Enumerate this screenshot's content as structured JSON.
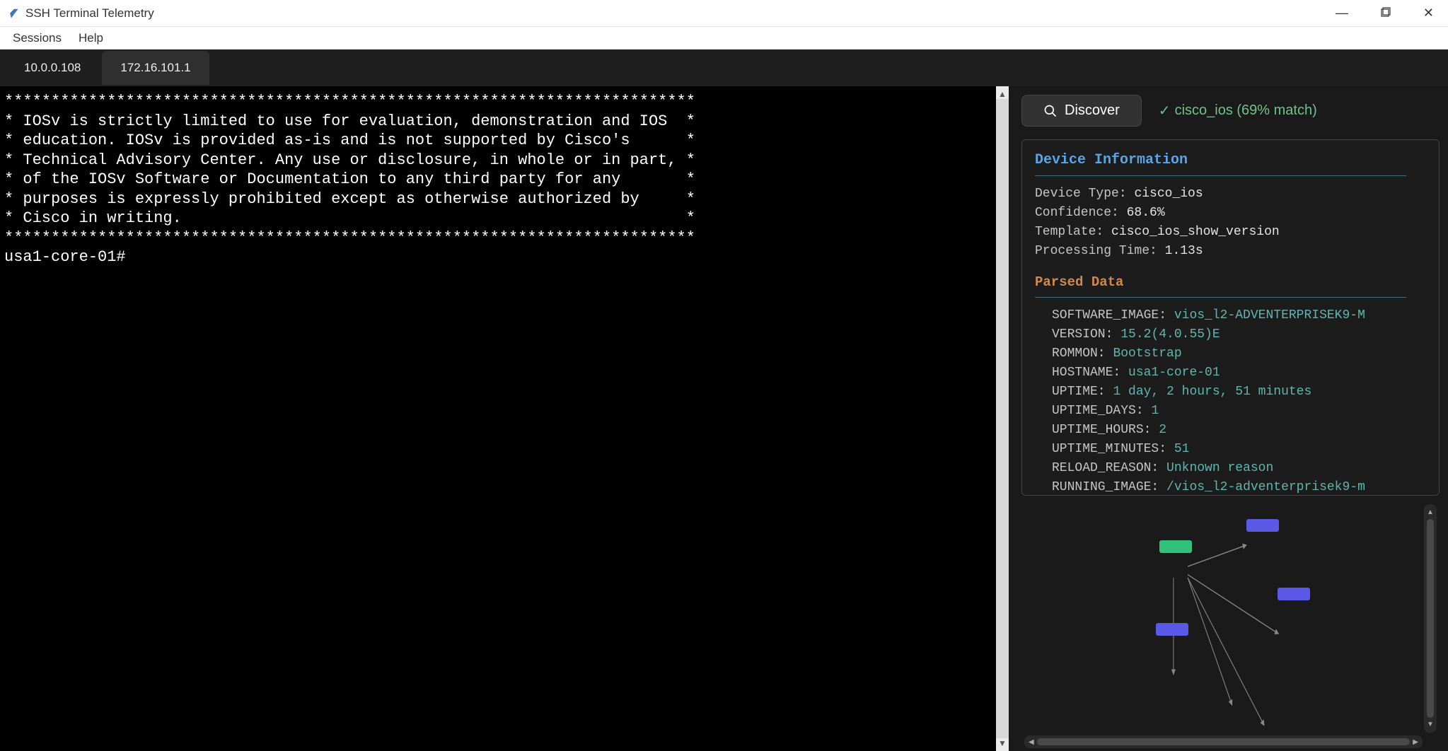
{
  "window": {
    "title": "SSH Terminal Telemetry"
  },
  "menubar": {
    "sessions": "Sessions",
    "help": "Help"
  },
  "tabs": [
    {
      "label": "10.0.0.108"
    },
    {
      "label": "172.16.101.1"
    }
  ],
  "terminal": {
    "lines": [
      "**************************************************************************",
      "* IOSv is strictly limited to use for evaluation, demonstration and IOS  *",
      "* education. IOSv is provided as-is and is not supported by Cisco's      *",
      "* Technical Advisory Center. Any use or disclosure, in whole or in part, *",
      "* of the IOSv Software or Documentation to any third party for any       *",
      "* purposes is expressly prohibited except as otherwise authorized by     *",
      "* Cisco in writing.                                                      *",
      "**************************************************************************",
      "usa1-core-01#"
    ]
  },
  "discover": {
    "button": "Discover",
    "status_check": "✓",
    "status_text": "cisco_ios (69% match)"
  },
  "device_info": {
    "heading": "Device Information",
    "lines": [
      {
        "k": "Device Type",
        "v": "cisco_ios"
      },
      {
        "k": "Confidence",
        "v": "68.6%"
      },
      {
        "k": "Template",
        "v": "cisco_ios_show_version"
      },
      {
        "k": "Processing Time",
        "v": "1.13s"
      }
    ],
    "parsed_heading": "Parsed Data",
    "parsed": [
      {
        "k": "SOFTWARE_IMAGE",
        "v": "vios_l2-ADVENTERPRISEK9-M"
      },
      {
        "k": "VERSION",
        "v": "15.2(4.0.55)E"
      },
      {
        "k": "ROMMON",
        "v": "Bootstrap"
      },
      {
        "k": "HOSTNAME",
        "v": "usa1-core-01"
      },
      {
        "k": "UPTIME",
        "v": "1 day, 2 hours, 51 minutes"
      },
      {
        "k": "UPTIME_DAYS",
        "v": "1"
      },
      {
        "k": "UPTIME_HOURS",
        "v": "2"
      },
      {
        "k": "UPTIME_MINUTES",
        "v": "51"
      },
      {
        "k": "RELOAD_REASON",
        "v": "Unknown reason"
      },
      {
        "k": "RUNNING_IMAGE",
        "v": "/vios_l2-adventerprisek9-m"
      }
    ]
  }
}
